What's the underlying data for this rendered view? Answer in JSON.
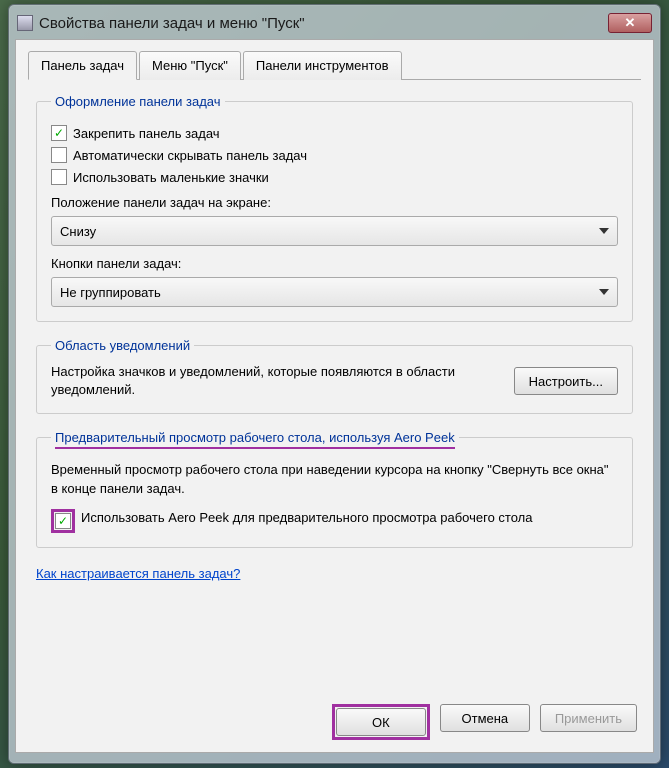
{
  "window": {
    "title": "Свойства панели задач и меню \"Пуск\""
  },
  "tabs": {
    "taskbar": "Панель задач",
    "start": "Меню \"Пуск\"",
    "toolbars": "Панели инструментов"
  },
  "appearance": {
    "legend": "Оформление панели задач",
    "lock": "Закрепить панель задач",
    "autohide": "Автоматически скрывать панель задач",
    "smallicons": "Использовать маленькие значки",
    "position_label": "Положение панели задач на экране:",
    "position_value": "Снизу",
    "buttons_label": "Кнопки панели задач:",
    "buttons_value": "Не группировать"
  },
  "notifications": {
    "legend": "Область уведомлений",
    "text": "Настройка значков и уведомлений, которые появляются в области уведомлений.",
    "button": "Настроить..."
  },
  "aero": {
    "legend": "Предварительный просмотр рабочего стола, используя Aero Peek",
    "desc": "Временный просмотр рабочего стола при наведении курсора на кнопку \"Свернуть все окна\" в конце панели задач.",
    "checkbox": "Использовать Aero Peek для предварительного просмотра рабочего стола"
  },
  "help_link": "Как настраивается панель задач?",
  "buttons": {
    "ok": "ОК",
    "cancel": "Отмена",
    "apply": "Применить"
  },
  "checkmark": "✓"
}
